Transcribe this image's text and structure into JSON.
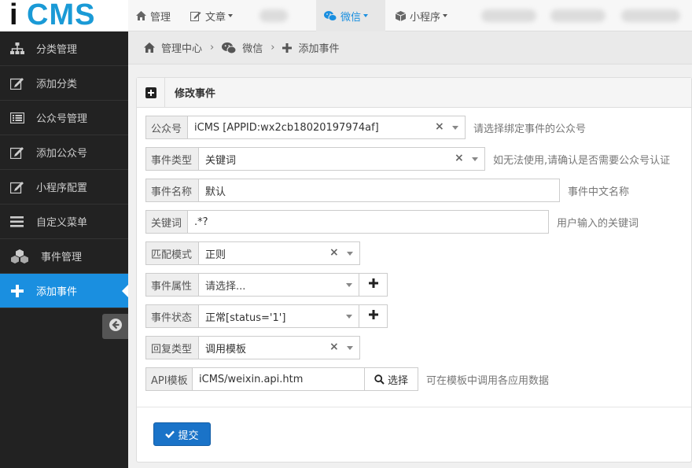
{
  "brand": {
    "i": "i",
    "cms": "CMS"
  },
  "topnav": [
    {
      "label": "管理",
      "icon": "home-icon"
    },
    {
      "label": "文章",
      "icon": "edit-icon"
    },
    {
      "label": "微信",
      "icon": "wechat-icon"
    },
    {
      "label": "小程序",
      "icon": "cube-icon"
    }
  ],
  "sidebar": {
    "items": [
      {
        "label": "分类管理",
        "icon": "sitemap-icon"
      },
      {
        "label": "添加分类",
        "icon": "edit-icon"
      },
      {
        "label": "公众号管理",
        "icon": "list-icon"
      },
      {
        "label": "添加公众号",
        "icon": "edit-icon"
      },
      {
        "label": "小程序配置",
        "icon": "edit-icon"
      },
      {
        "label": "自定义菜单",
        "icon": "bars-icon"
      },
      {
        "label": "事件管理",
        "icon": "cubes-icon"
      },
      {
        "label": "添加事件",
        "icon": "plus-icon"
      }
    ]
  },
  "breadcrumb": [
    "管理中心",
    "微信",
    "添加事件"
  ],
  "panel": {
    "title": "修改事件"
  },
  "form": {
    "account": {
      "label": "公众号",
      "value": "iCMS [APPID:wx2cb18020197974af]",
      "help": "请选择绑定事件的公众号"
    },
    "event_type": {
      "label": "事件类型",
      "value": "关键词",
      "help": "如无法使用,请确认是否需要公众号认证"
    },
    "event_name": {
      "label": "事件名称",
      "value": "默认",
      "help": "事件中文名称"
    },
    "keyword": {
      "label": "关键词",
      "value": ".*?",
      "help": "用户输入的关键词"
    },
    "match_mode": {
      "label": "匹配模式",
      "value": "正则"
    },
    "event_attr": {
      "label": "事件属性",
      "value": "请选择..."
    },
    "event_status": {
      "label": "事件状态",
      "value": "正常[status='1']"
    },
    "reply_type": {
      "label": "回复类型",
      "value": "调用模板"
    },
    "api_template": {
      "label": "API模板",
      "value": "iCMS/weixin.api.htm",
      "button": "选择",
      "help": "可在模板中调用各应用数据"
    }
  },
  "submit_label": "提交",
  "colors": {
    "accent": "#1a8fe0",
    "sidebar_bg": "#222222",
    "submit": "#1a73c8"
  }
}
